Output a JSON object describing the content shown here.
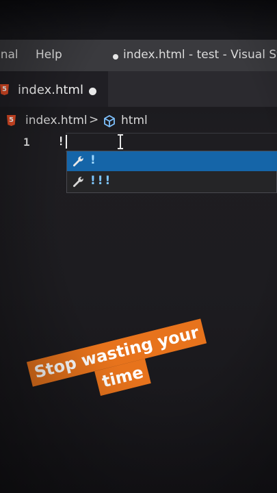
{
  "menu": {
    "terminal_partial": "inal",
    "help": "Help"
  },
  "window": {
    "title": "index.html - test - Visual Studio"
  },
  "tab": {
    "label": "index.html",
    "unsaved": true
  },
  "breadcrumb": {
    "file": "index.html",
    "separator": ">",
    "element": "html"
  },
  "editor": {
    "line_number": "1",
    "typed_text": "!"
  },
  "suggestions": {
    "items": [
      {
        "label": "!",
        "icon": "wrench-icon",
        "selected": true
      },
      {
        "label": "!!!",
        "icon": "wrench-icon",
        "selected": false
      }
    ]
  },
  "caption": {
    "line1": "Stop wasting your",
    "line2": "time"
  },
  "colors": {
    "accent_selection": "#1565a8",
    "caption_bg": "#e7731c",
    "html5": "#e44d26"
  }
}
